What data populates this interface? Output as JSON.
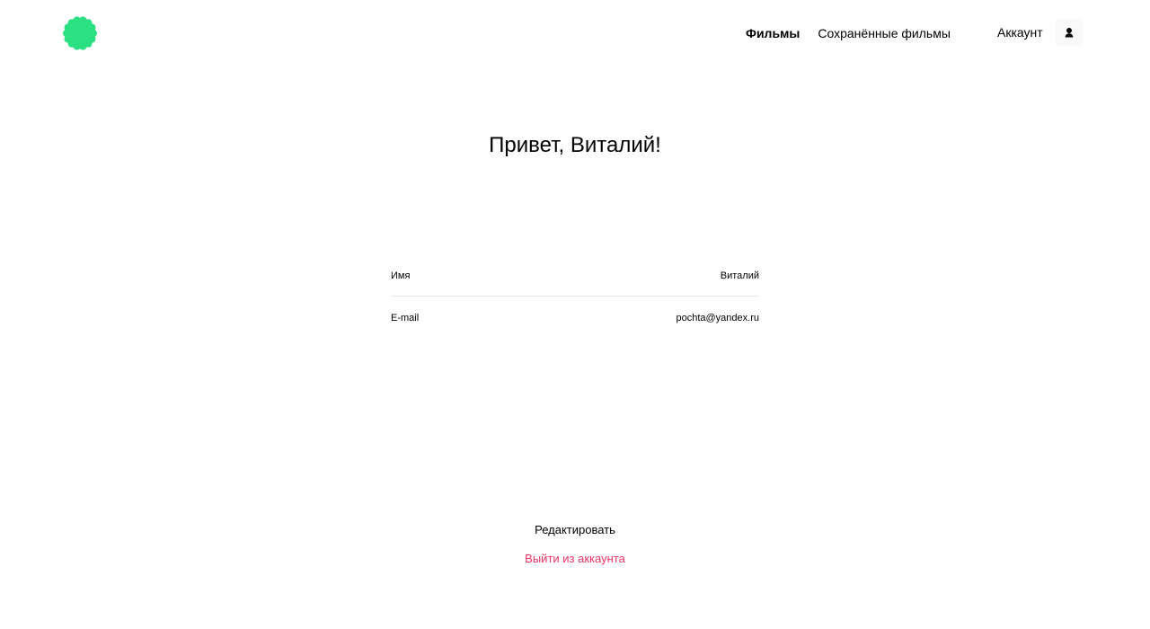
{
  "colors": {
    "accent": "#2be080",
    "danger": "#ee3465",
    "divider": "#e8e8e8",
    "icon_box_bg": "#f9f9f9"
  },
  "header": {
    "logo_icon": "logo-flower-icon",
    "nav": [
      {
        "label": "Фильмы",
        "active": true
      },
      {
        "label": "Сохранённые фильмы",
        "active": false
      }
    ],
    "account_label": "Аккаунт",
    "account_icon": "user-icon"
  },
  "main": {
    "greeting": "Привет, Виталий!",
    "profile": [
      {
        "label": "Имя",
        "value": "Виталий"
      },
      {
        "label": "E-mail",
        "value": "pochta@yandex.ru"
      }
    ],
    "edit_label": "Редактировать",
    "logout_label": "Выйти из аккаунта"
  }
}
